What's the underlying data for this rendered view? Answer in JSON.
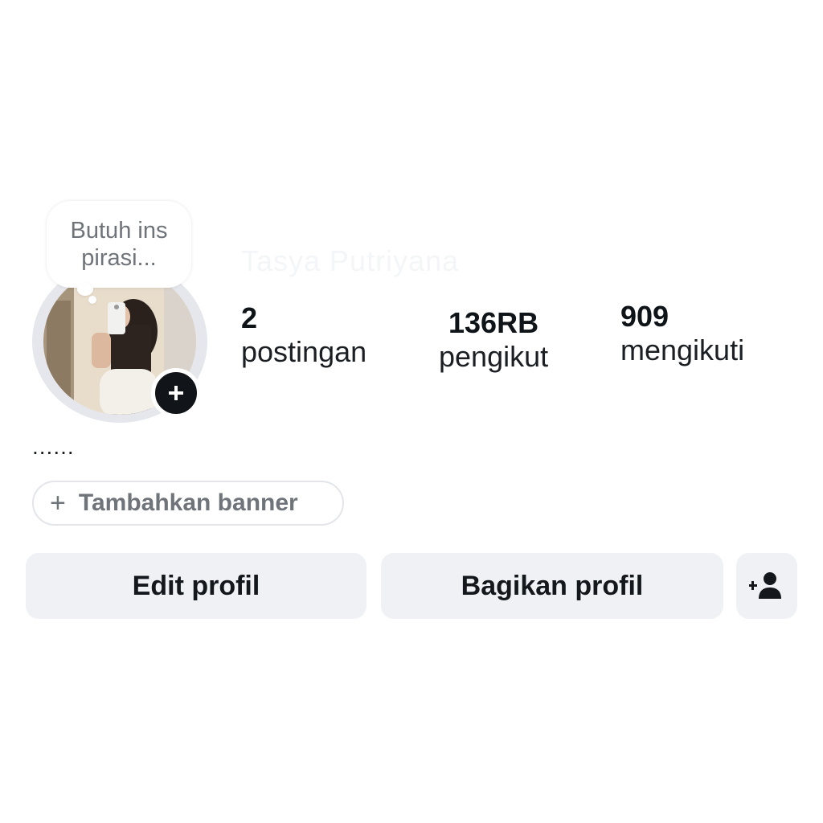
{
  "note": {
    "text": "Butuh ins pirasi..."
  },
  "profile": {
    "display_name": "Tasya Putriyana",
    "bio": "......"
  },
  "stats": {
    "posts": {
      "count": "2",
      "label": "postingan"
    },
    "followers": {
      "count": "136RB",
      "label": "pengikut"
    },
    "following": {
      "count": "909",
      "label": "mengikuti"
    }
  },
  "banner_button": {
    "label": "Tambahkan banner",
    "icon": "plus-icon"
  },
  "actions": {
    "edit_label": "Edit profil",
    "share_label": "Bagikan profil",
    "suggest_icon": "add-person-icon"
  },
  "colors": {
    "button_bg": "#eff1f5",
    "badge_bg": "#111418",
    "muted_text": "#6f737a"
  }
}
